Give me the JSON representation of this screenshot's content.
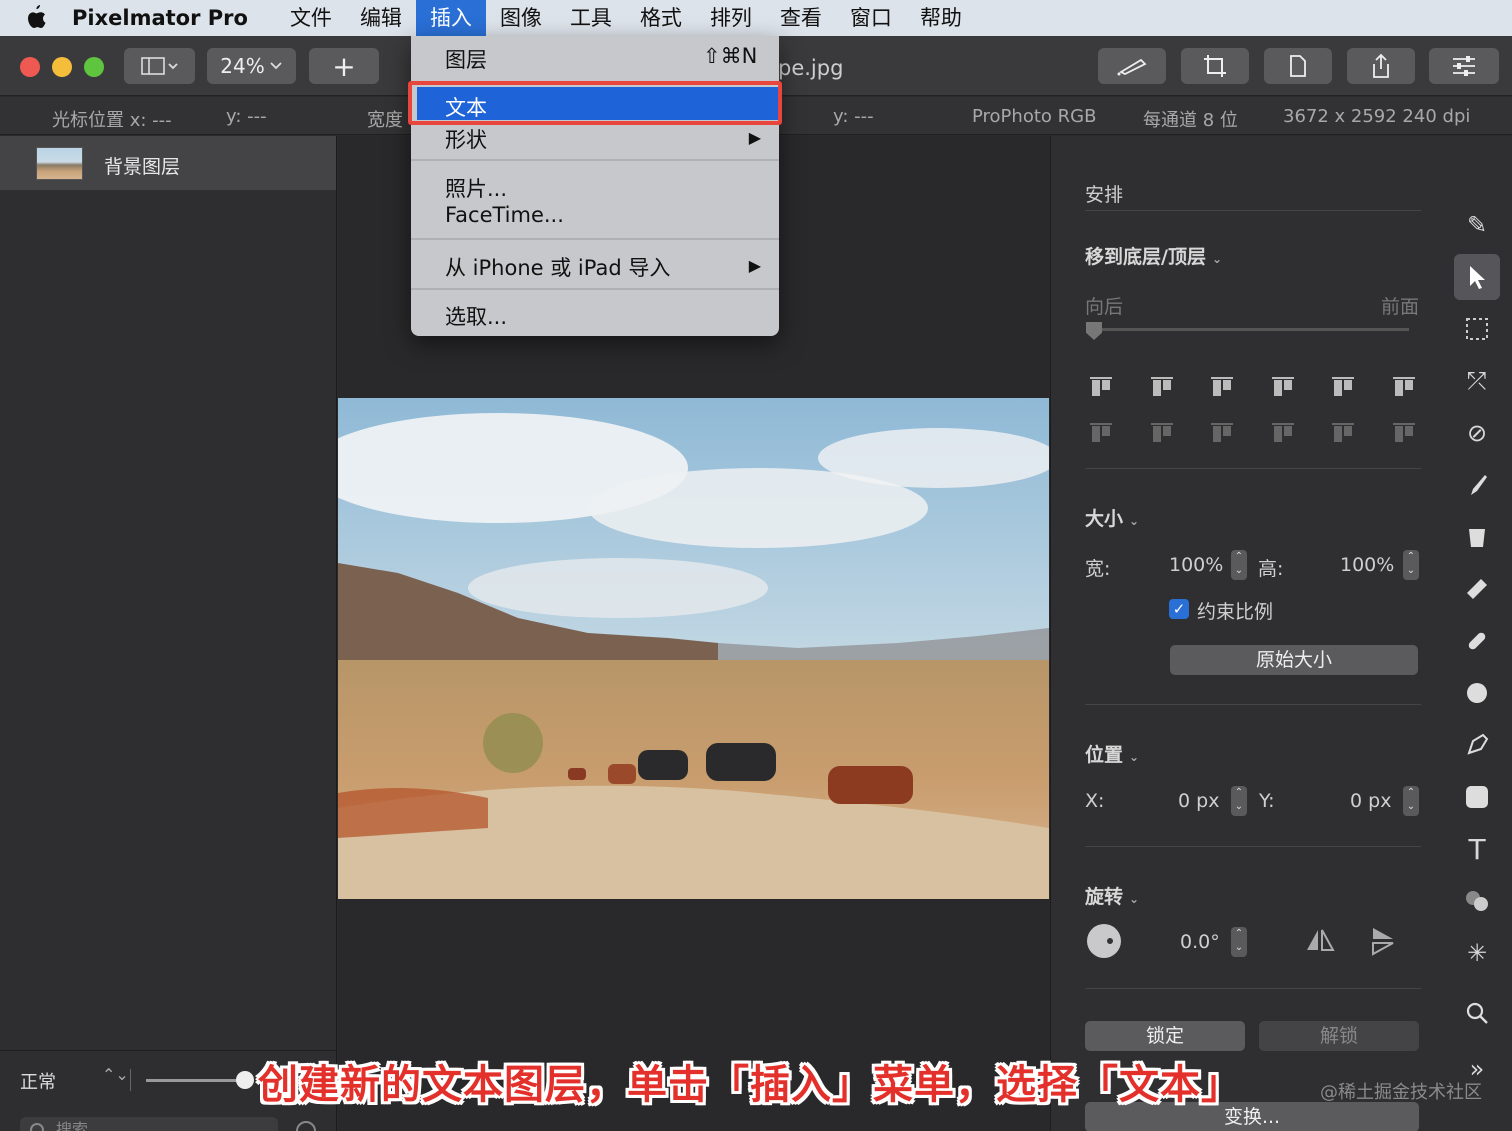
{
  "menubar": {
    "app_name": "Pixelmator Pro",
    "items": [
      "文件",
      "编辑",
      "插入",
      "图像",
      "工具",
      "格式",
      "排列",
      "查看",
      "窗口",
      "帮助"
    ],
    "active_index": 2
  },
  "toolbar": {
    "zoom": "24%",
    "add_label": "+",
    "document_title_fragment": "pe.jpg"
  },
  "infobar": {
    "cursor_x": "光标位置 x:  ---",
    "cursor_y": "y:  ---",
    "width_label": "宽度",
    "y2": "y:  ---",
    "color_profile": "ProPhoto RGB",
    "bit_depth": "每通道 8 位",
    "dimensions": "3672 x 2592 240 dpi"
  },
  "layers": {
    "items": [
      {
        "name": "背景图层"
      }
    ],
    "blend_mode": "正常",
    "search_placeholder": "搜索"
  },
  "insert_menu": {
    "layer": "图层",
    "layer_shortcut": "⇧⌘N",
    "text": "文本",
    "shape": "形状",
    "photo": "照片...",
    "facetime": "FaceTime...",
    "import_iphone": "从 iPhone 或 iPad 导入",
    "select": "选取..."
  },
  "inspector": {
    "arrange_title": "安排",
    "move_title": "移到底层/顶层",
    "back_label": "向后",
    "front_label": "前面",
    "size_title": "大小",
    "width_label": "宽:",
    "width_value": "100%",
    "height_label": "高:",
    "height_value": "100%",
    "constrain_label": "约束比例",
    "constrain_checked": true,
    "original_size_button": "原始大小",
    "position_title": "位置",
    "x_label": "X:",
    "x_value": "0 px",
    "y_label": "Y:",
    "y_value": "0 px",
    "rotate_title": "旋转",
    "rotate_value": "0.0°",
    "lock_button": "锁定",
    "unlock_button": "解锁",
    "transform_button": "变换..."
  },
  "caption": "创建新的文本图层，单击「插入」菜单，选择「文本」",
  "watermark": "@稀土掘金技术社区",
  "colors": {
    "accent": "#1f63d8",
    "highlight_box": "#e8453c",
    "caption": "#e4302a"
  }
}
